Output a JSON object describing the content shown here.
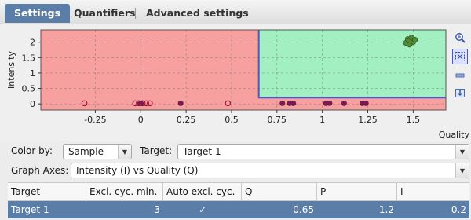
{
  "tabs": [
    {
      "label": "Settings",
      "active": true
    },
    {
      "label": "Quantifiers",
      "active": false
    },
    {
      "label": "Advanced settings",
      "active": false
    }
  ],
  "chart_data": {
    "type": "scatter",
    "xlabel": "Quality",
    "ylabel": "Intensity",
    "xlim": [
      -0.55,
      1.68
    ],
    "ylim": [
      -0.2,
      2.4
    ],
    "x_ticks": [
      -0.25,
      0,
      0.25,
      0.5,
      0.75,
      1,
      1.25,
      1.5
    ],
    "x_tick_labels": [
      "-0.25",
      "0",
      "0.25",
      "0.5",
      "0.75",
      "1",
      "1.25",
      "1.5"
    ],
    "y_ticks": [
      0,
      0.5,
      1,
      1.5,
      2
    ],
    "y_tick_labels": [
      "0",
      "0.5",
      "1",
      "1.5",
      "2"
    ],
    "grid": true,
    "threshold": {
      "quality": 0.65,
      "intensity": 0.2
    },
    "region_colors": {
      "excluded": "#f6a0a0",
      "included": "#a2f0c2",
      "boundary": "#4e57c4"
    },
    "series": [
      {
        "color": "#a0132e",
        "filled": false,
        "points": [
          {
            "x": -0.31,
            "y": 0.02
          },
          {
            "x": 0.48,
            "y": 0.02
          }
        ]
      },
      {
        "color": "#a0132e",
        "filled": false,
        "points": [
          {
            "x": -0.03,
            "y": 0.02
          },
          {
            "x": -0.01,
            "y": 0.02
          },
          {
            "x": 0.01,
            "y": 0.02
          },
          {
            "x": 0.03,
            "y": 0.02
          },
          {
            "x": 0.05,
            "y": 0.02
          }
        ]
      },
      {
        "color": "#8b1058",
        "filled": true,
        "points": [
          {
            "x": 0.0,
            "y": 0.02
          },
          {
            "x": 0.22,
            "y": 0.02
          },
          {
            "x": 0.78,
            "y": 0.02
          },
          {
            "x": 0.82,
            "y": 0.02
          },
          {
            "x": 0.84,
            "y": 0.02
          },
          {
            "x": 1.02,
            "y": 0.02
          },
          {
            "x": 1.04,
            "y": 0.02
          },
          {
            "x": 1.12,
            "y": 0.02
          },
          {
            "x": 1.22,
            "y": 0.02
          },
          {
            "x": 1.24,
            "y": 0.02
          }
        ]
      },
      {
        "color": "#4d8f2a",
        "filled": true,
        "points": [
          {
            "x": 1.46,
            "y": 1.98
          },
          {
            "x": 1.47,
            "y": 2.1
          },
          {
            "x": 1.48,
            "y": 2.05
          },
          {
            "x": 1.49,
            "y": 2.15
          },
          {
            "x": 1.5,
            "y": 2.0
          },
          {
            "x": 1.51,
            "y": 2.08
          },
          {
            "x": 1.48,
            "y": 1.92
          }
        ]
      }
    ]
  },
  "toolbar_icons": [
    "zoom-in-icon",
    "select-region-icon",
    "minus-icon",
    "export-icon"
  ],
  "color_by": {
    "label": "Color by:",
    "value": "Sample"
  },
  "target": {
    "label": "Target:",
    "value": "Target 1"
  },
  "graph_axes": {
    "label": "Graph Axes:",
    "value": "Intensity (I) vs Quality (Q)"
  },
  "table": {
    "columns": [
      "Target",
      "Excl. cyc. min.",
      "Auto excl. cyc.",
      "Q",
      "P",
      "I"
    ],
    "rows": [
      {
        "target": "Target 1",
        "excl_cyc_min": "3",
        "auto_excl": "✓",
        "q": "0.65",
        "p": "1.2",
        "i": "0.2"
      }
    ]
  }
}
